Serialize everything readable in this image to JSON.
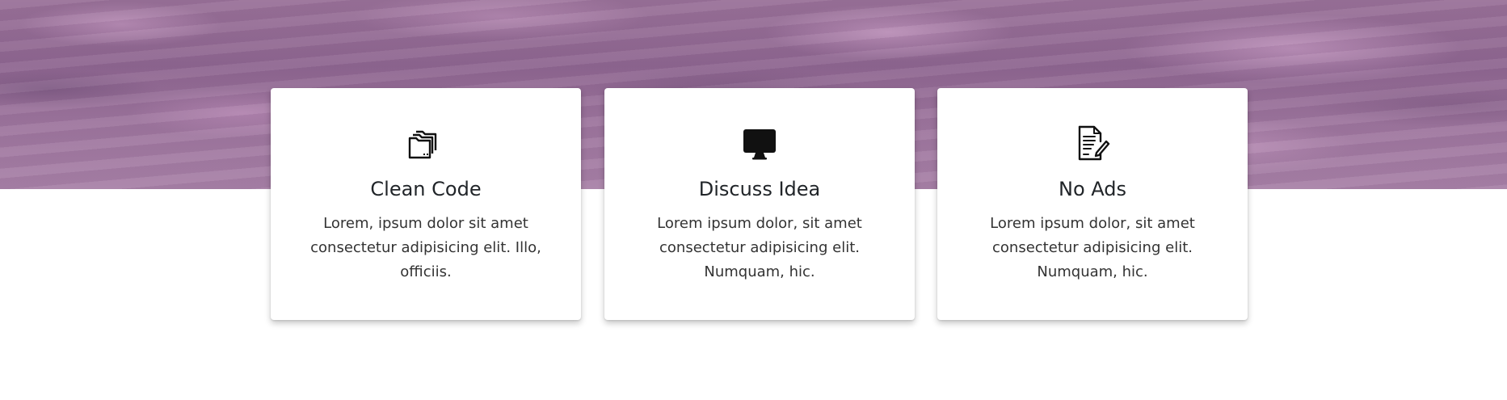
{
  "features": [
    {
      "icon": "folders-icon",
      "title": "Clean Code",
      "text": "Lorem, ipsum dolor sit amet consectetur adipisicing elit. Illo, officiis."
    },
    {
      "icon": "monitor-icon",
      "title": "Discuss Idea",
      "text": "Lorem ipsum dolor, sit amet consectetur adipisicing elit. Numquam, hic."
    },
    {
      "icon": "document-edit-icon",
      "title": "No Ads",
      "text": "Lorem ipsum dolor, sit amet consectetur adipisicing elit. Numquam, hic."
    }
  ],
  "colors": {
    "hero_purple": "#9a7299",
    "card_background": "#ffffff",
    "text": "#212529"
  }
}
